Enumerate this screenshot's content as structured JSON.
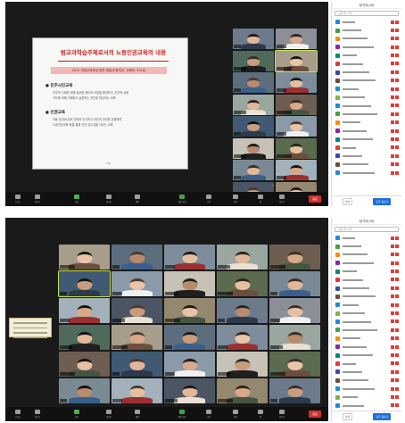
{
  "top": {
    "slide": {
      "title": "범교과학습주제로서의 노동인권교육의 내용",
      "subtitle": "2015 개정교육과정 총론 해설(초등학교, 교육부, 2016)",
      "section1": "● 민주시민교육",
      "section1_body": [
        "민주적 사회를 위해 필요한 태도와 자질을 함양하고, 민주적 공동",
        "가치에 대해 이해하고 실천하는 개인을 형성하는 교육"
      ],
      "section2": "● 인권교육",
      "section2_body": [
        "아동 및 청소년의 권리를 인식하고 타인의 권리를 존중하며",
        "노동인권교육 등을 통해 인권 감수성을 기르는 교육"
      ],
      "page": "2/8"
    },
    "participants_panel_title": "참가자(49)",
    "search_placeholder": "노동인권 검색",
    "leave_label": "종료",
    "footer": {
      "mute_all": "모두 음소거",
      "more": "초대"
    }
  },
  "bottom": {
    "participants_panel_title": "참가자(49)",
    "search_placeholder": "노동인권 검색",
    "leave_label": "종료",
    "footer": {
      "mute_all": "모두 음소거",
      "more": "초대"
    }
  },
  "toolbar": {
    "buttons": [
      "오디오",
      "비디오",
      "보안",
      "참가자",
      "채팅",
      "화면 공유",
      "기록",
      "반응",
      "앱",
      "더보기"
    ]
  },
  "colors": {
    "accent": "#1e6fd9",
    "muted": "#e53935",
    "active_speaker": "#c6e04a",
    "leave": "#d32f2f"
  }
}
